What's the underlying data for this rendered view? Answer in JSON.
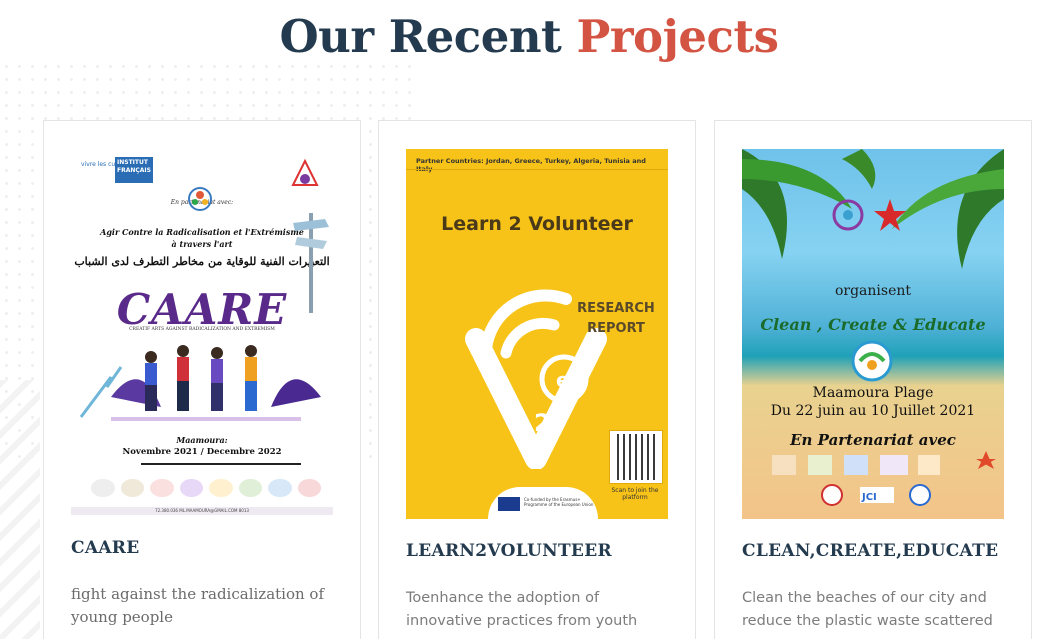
{
  "section": {
    "heading_part1": "Our Recent",
    "heading_part2": "Projects",
    "accent_color": "#d45443",
    "heading_color": "#243b4f"
  },
  "projects": [
    {
      "title": "CAARE",
      "description": "fight against the radicalization of young people",
      "poster": {
        "partner_line": "En partenariat avec:",
        "line1": "Agir Contre la Radicalisation et l'Extrémisme",
        "line2": "à travers l'art",
        "line3_ar": "التعبيرات الفنية للوقاية من مخاطر التطرف لدى الشباب",
        "name": "CAARE",
        "subtitle": "CREATIF ARTS AGAINST RADICALIZATION AND EXTREMISM",
        "date_line1": "Maamoura:",
        "date_line2": "Novembre 2021 / Decembre 2022",
        "logo_text": "INSTITUT FRANÇAIS",
        "logo_small": "vivre les cultures",
        "footer": "72.380.036   ML.MAAMOURA@GMAIL.COM   8013"
      }
    },
    {
      "title": "LEARN2VOLUNTEER",
      "description": "Toenhance the adoption of innovative practices from youth",
      "poster": {
        "partners": "Partner Countries: Jordan, Greece, Turkey, Algeria, Tunisia and Italy",
        "title": "Learn 2 Volunteer",
        "report_line1": "RESEARCH",
        "report_line2": "REPORT",
        "scan": "Scan to join the platform",
        "eu": "Co-funded by the Erasmus+ Programme of the European Union"
      }
    },
    {
      "title": "CLEAN,CREATE,EDUCATE",
      "description": "Clean the beaches of our city and reduce the plastic waste scattered",
      "poster": {
        "organise": "organisent",
        "event": "Clean , Create & Educate",
        "location": "Maamoura Plage",
        "dates": "Du 22 juin au 10 Juillet 2021",
        "partner": "En Partenariat avec"
      }
    }
  ]
}
